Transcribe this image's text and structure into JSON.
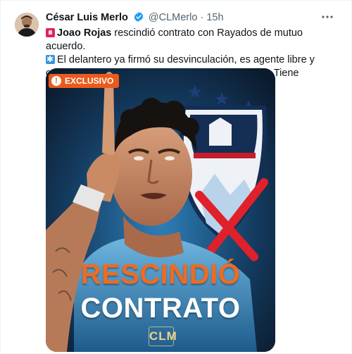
{
  "author": {
    "name": "César Luis Merlo",
    "handle": "@CLMerlo",
    "separator": "·",
    "time": "15h",
    "avatar_icon": "profile-photo"
  },
  "tweet": {
    "line1_bold": "Joao Rojas",
    "line1_rest": " rescindió contrato con Rayados de mutuo acuerdo.",
    "line2": "El delantero ya firmó su desvinculación, es agente libre y comienza a analizar cuál será su futuro deportivo. Tiene propuestas de Brasil y Rusia.",
    "emoji1": "police-car-light-icon",
    "emoji2": "snowflake-icon"
  },
  "media": {
    "badge_label": "EXCLUSIVO",
    "headline_line1": "RESCINDIÓ",
    "headline_line2": "CONTRATO",
    "brand_mark": "CLM",
    "colors": {
      "background": "#0e1f33",
      "accent": "#ea5a1c",
      "cross": "#e0202a"
    }
  },
  "colors": {
    "verified": "#1d9bf0",
    "secondary_text": "#536471"
  }
}
